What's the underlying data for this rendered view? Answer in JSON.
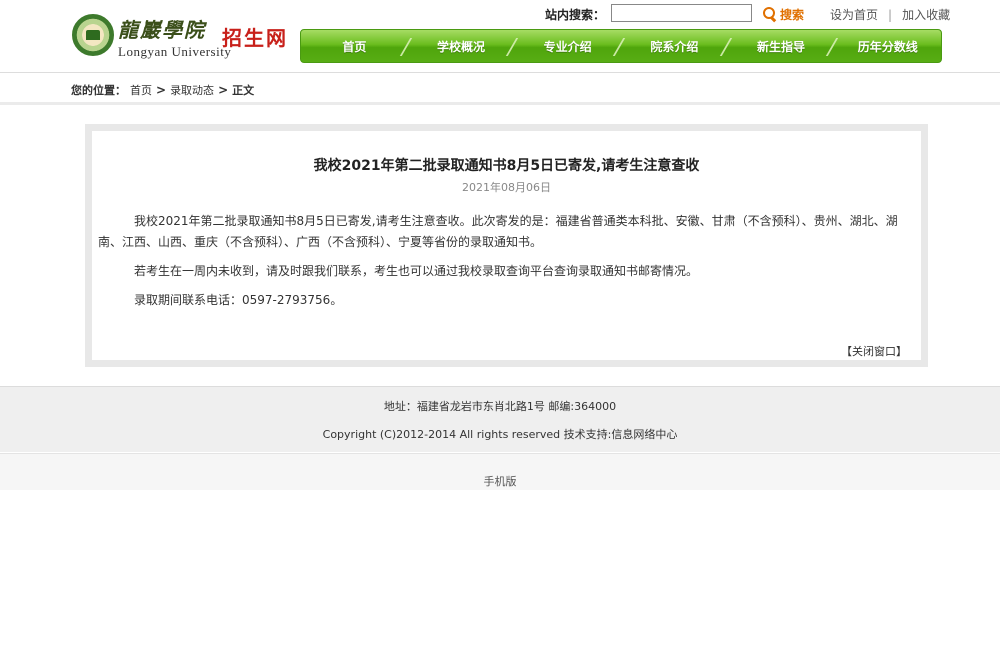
{
  "header": {
    "logo_cn": "龍巖學院",
    "logo_en": "Longyan  University",
    "logo_sub": "招生网",
    "search_label": "站内搜索：",
    "search_value": "",
    "search_button": "搜索",
    "link_home": "设为首页",
    "link_sep": "|",
    "link_fav": "加入收藏"
  },
  "nav": {
    "items": [
      "首页",
      "学校概况",
      "专业介绍",
      "院系介绍",
      "新生指导",
      "历年分数线"
    ]
  },
  "breadcrumb": {
    "label": "您的位置：",
    "items": [
      "首页",
      "录取动态",
      "正文"
    ],
    "sep": ">"
  },
  "article": {
    "title": "我校2021年第二批录取通知书8月5日已寄发,请考生注意查收",
    "date": "2021年08月06日",
    "paragraphs": [
      "我校2021年第二批录取通知书8月5日已寄发,请考生注意查收。此次寄发的是：福建省普通类本科批、安徽、甘肃（不含预科）、贵州、湖北、湖南、江西、山西、重庆（不含预科）、广西（不含预科）、宁夏等省份的录取通知书。",
      "若考生在一周内未收到，请及时跟我们联系，考生也可以通过我校录取查询平台查询录取通知书邮寄情况。",
      "录取期间联系电话：0597-2793756。"
    ],
    "close_label": "【关闭窗口】"
  },
  "footer": {
    "address": "地址：福建省龙岩市东肖北路1号  邮编:364000",
    "copyright": "Copyright (C)2012-2014  All rights reserved 技术支持:信息网络中心",
    "mobile": "手机版"
  },
  "colors": {
    "nav_green": "#58ad14",
    "search_orange": "#e07000",
    "logo_red": "#c8201a"
  }
}
